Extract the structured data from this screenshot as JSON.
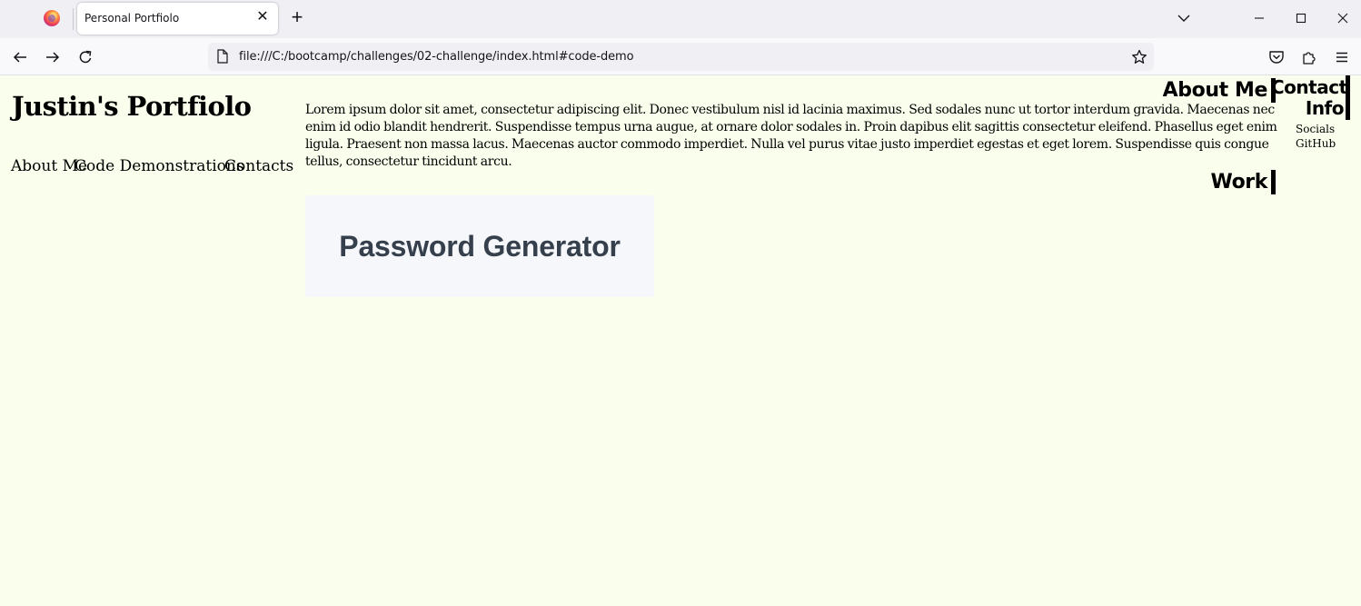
{
  "browser": {
    "tab_title": "Personal Portfiolo",
    "url": "file:///C:/bootcamp/challenges/02-challenge/index.html#code-demo"
  },
  "site": {
    "title": "Justin's Portfiolo",
    "nav": {
      "about": "About Me",
      "code": "Code Demonstrations",
      "contacts": "Contacts"
    },
    "about_heading": "About Me",
    "about_text": "Lorem ipsum dolor sit amet, consectetur adipiscing elit. Donec vestibulum nisl id lacinia maximus. Sed sodales nunc ut tortor interdum gravida. Maecenas nec enim id odio blandit hendrerit. Suspendisse tempus urna augue, at ornare dolor sodales in. Proin dapibus elit sagittis consectetur eleifend. Phasellus eget enim ligula. Praesent non massa lacus. Maecenas auctor commodo imperdiet. Nulla vel purus vitae justo imperdiet egestas et eget lorem. Suspendisse quis congue tellus, consectetur tincidunt arcu.",
    "work_heading": "Work",
    "project_title": "Password Generator",
    "contact": {
      "heading": "Contact Info",
      "items": [
        "Socials",
        "GitHub"
      ]
    }
  },
  "colors": {
    "page_background": "#f9ffec",
    "card_background": "#f5f7fa",
    "card_text": "#36404c"
  }
}
